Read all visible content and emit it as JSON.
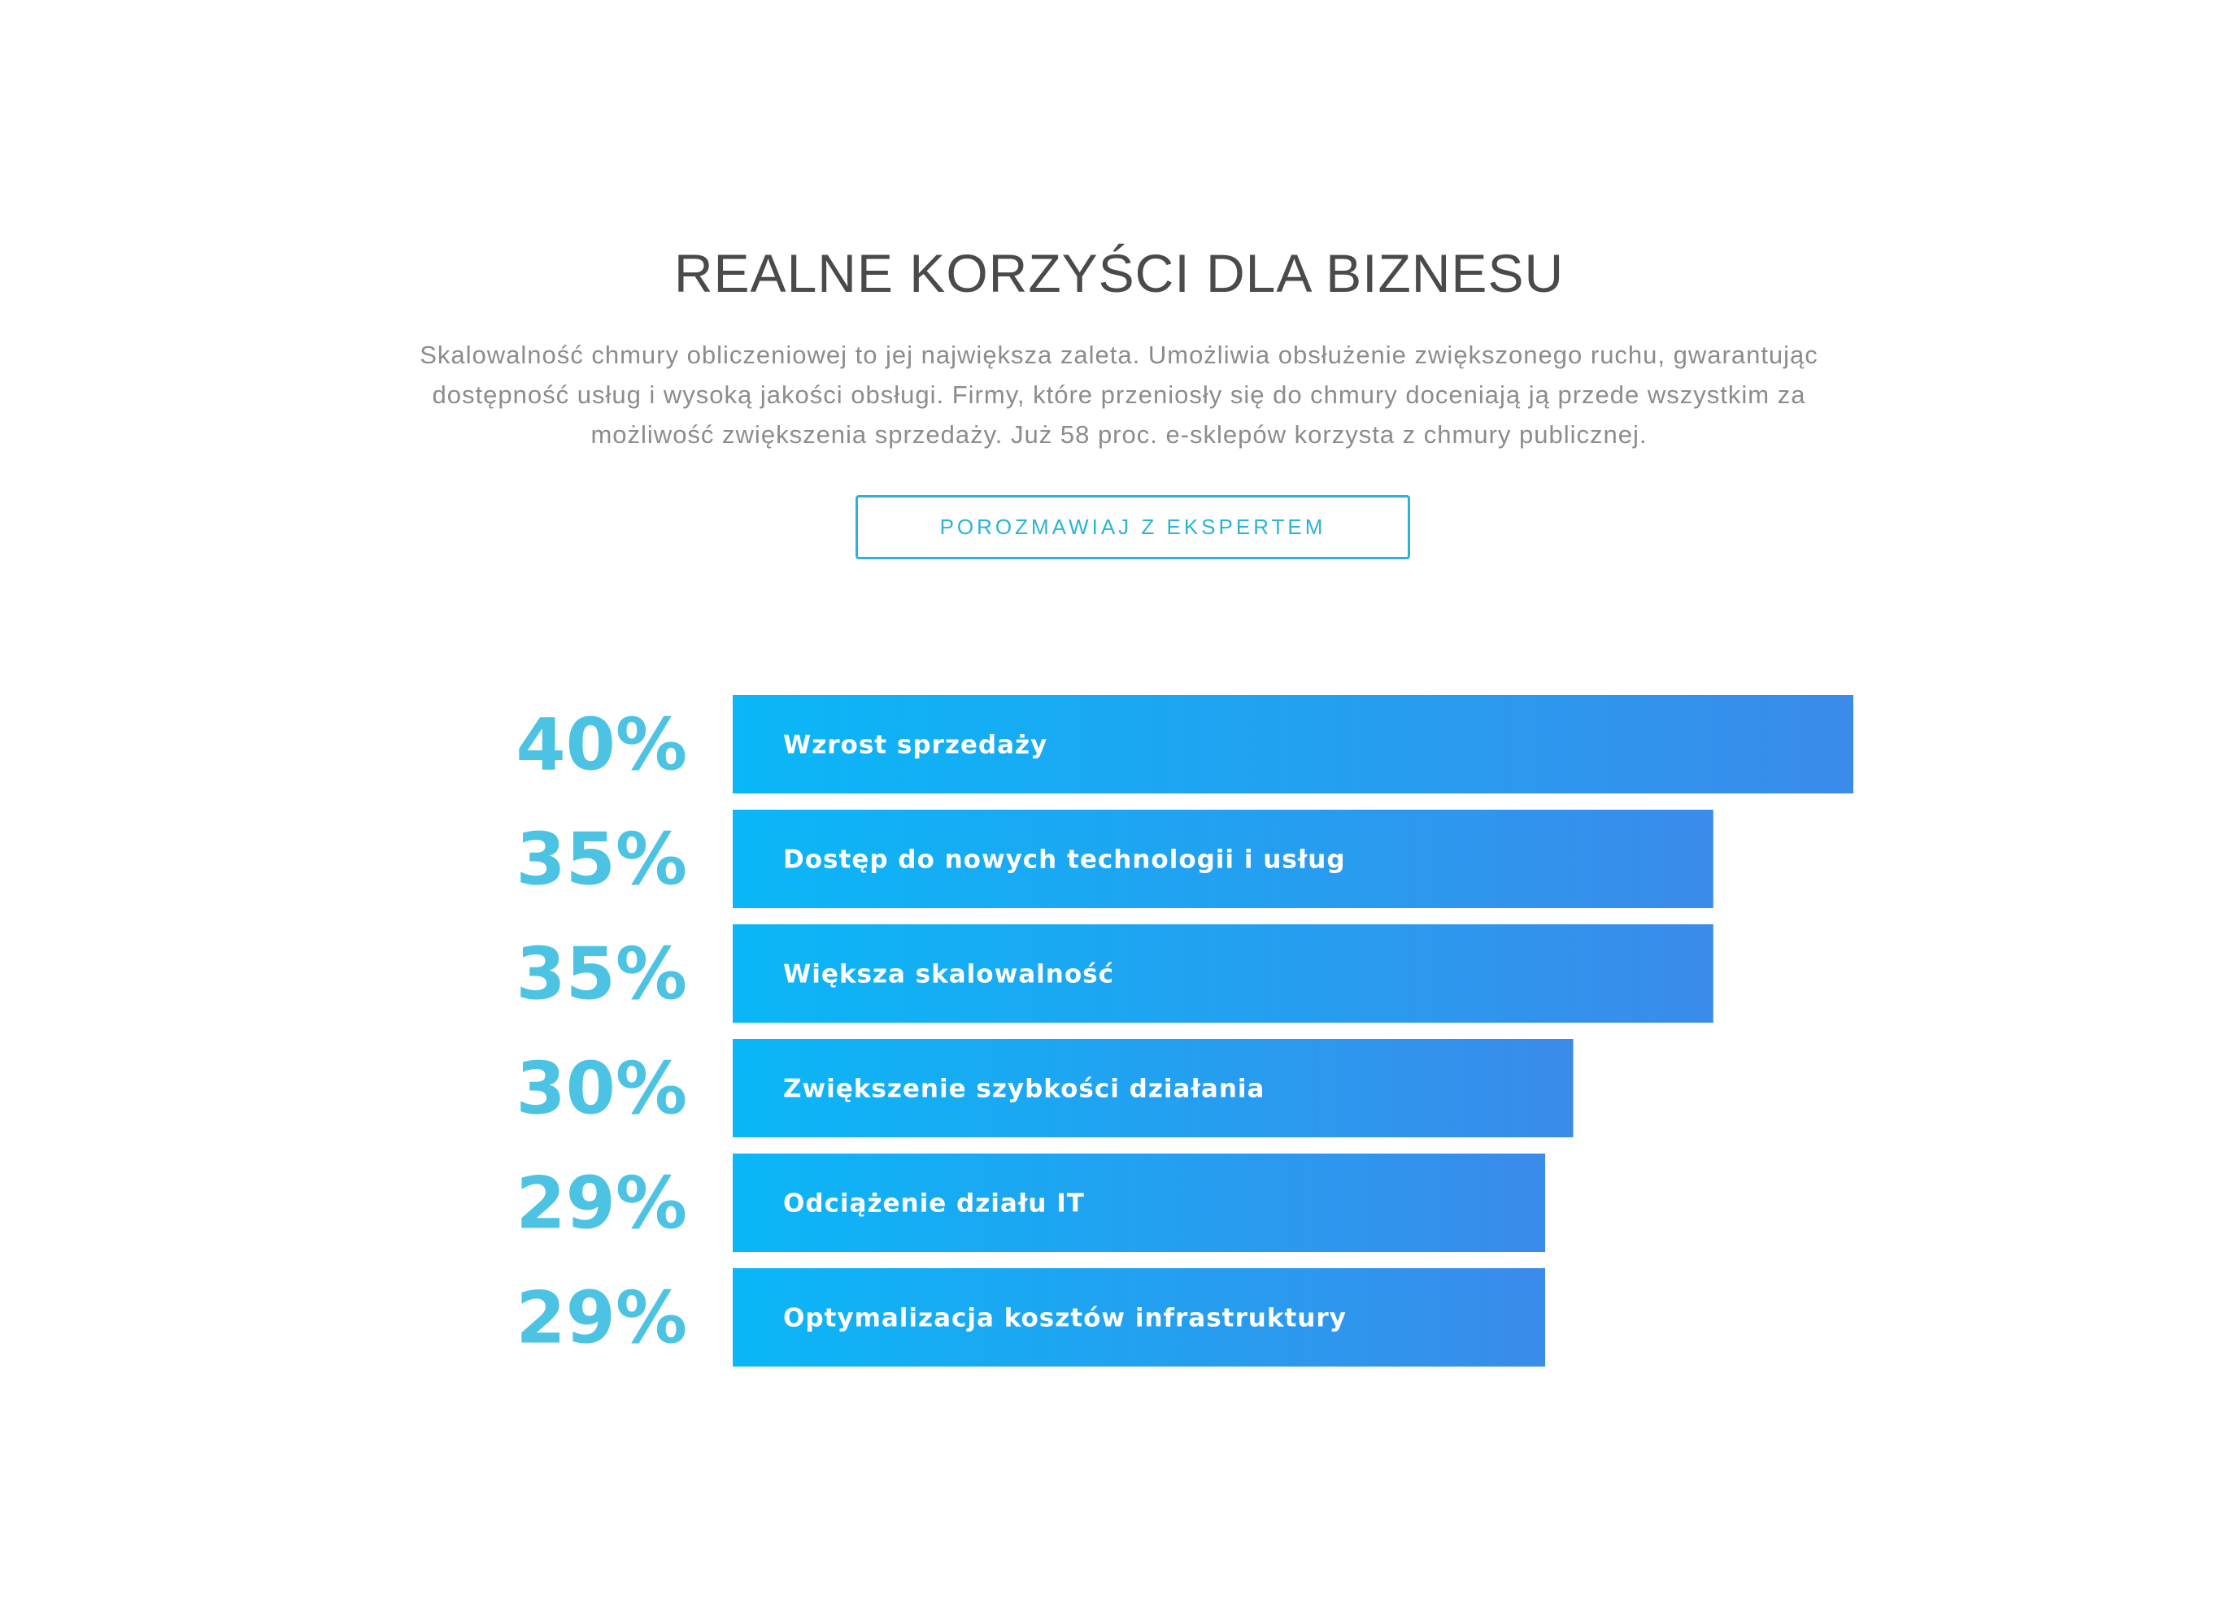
{
  "header": {
    "title": "REALNE KORZYŚCI DLA BIZNESU",
    "description": "Skalowalność chmury obliczeniowej to jej największa zaleta. Umożliwia obsłużenie zwiększonego ruchu, gwarantując dostępność usług i wysoką jakości obsługi. Firmy, które przeniosły się do chmury doceniają ją przede wszystkim za możliwość zwiększenia sprzedaży. Już 58 proc. e-sklepów korzysta z chmury publicznej."
  },
  "cta": {
    "label": "POROZMAWIAJ Z EKSPERTEM"
  },
  "colors": {
    "accent": "#2bb3d6",
    "percent_text": "#4dc3e3",
    "bar_gradient_start": "#0ab7f7",
    "bar_gradient_end": "#3a8bea"
  },
  "chart_data": {
    "type": "bar",
    "orientation": "horizontal",
    "categories": [
      "Wzrost sprzedaży",
      "Dostęp do nowych technologii i usług",
      "Większa skalowalność",
      "Zwiększenie szybkości działania",
      "Odciążenie działu IT",
      "Optymalizacja kosztów infrastruktury"
    ],
    "values": [
      40,
      35,
      35,
      30,
      29,
      29
    ],
    "value_labels": [
      "40%",
      "35%",
      "35%",
      "30%",
      "29%",
      "29%"
    ],
    "unit": "%",
    "grid": false,
    "legend": "none"
  }
}
